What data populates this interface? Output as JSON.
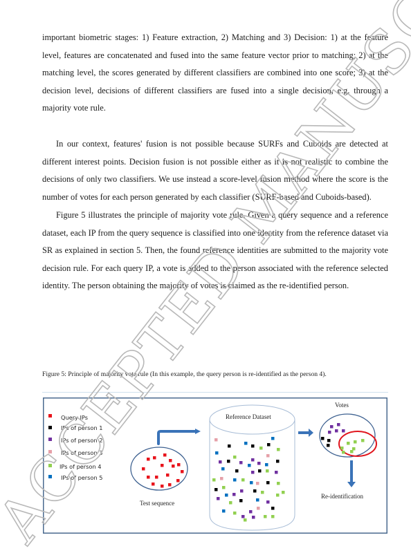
{
  "paragraphs": [
    {
      "text": "important biometric stages: 1) Feature extraction, 2) Matching and 3) Decision: 1) at the feature level, features are concatenated and fused into the same feature vector prior to matching; 2) at the matching level, the scores generated by different classifiers are combined into one score; 3) at the decision level, decisions of different classifiers are fused into a single decision, e.g.  through a majority vote rule.",
      "indent": false
    },
    {
      "text": "In our context, features' fusion is not possible because SURFs and Cuboids are detected at different interest points.  Decision fusion is not possible either as it is not realistic to combine the decisions of only two classifiers.  We use instead a score-level fusion method where the score is the number of votes for each person generated by each classifier (SURF-based and Cuboids-based).",
      "indent": true
    },
    {
      "text": "Figure 5 illustrates the principle of majority vote rule.  Given a query sequence and a reference dataset, each IP from the query sequence is classified into one identity from the reference dataset via SR as explained in section 5.  Then, the found reference identities are submitted to the majority vote decision rule. For each query IP, a vote is added to the person associated with the reference selected identity.  The person obtaining the majority of votes is claimed as the re-identified person.",
      "indent": true
    }
  ],
  "figure": {
    "caption": "Figure 5: Principle of majority vote rule (In this example, the query person is re-identified as the person 4).",
    "legend": [
      {
        "label": "Query IPs",
        "color": "#e8141c"
      },
      {
        "label": "IPs of person 1",
        "color": "#000000"
      },
      {
        "label": "IPs of person 2",
        "color": "#7030a0"
      },
      {
        "label": "IPs of person 3",
        "color": "#e6a0a8"
      },
      {
        "label": "IPs of person 4",
        "color": "#92d050"
      },
      {
        "label": "IPs of person 5",
        "color": "#0070c0"
      }
    ],
    "test_sequence_label": "Test sequence",
    "reference_dataset_label": "Reference Dataset",
    "votes_label": "Votes",
    "reidentification_label": "Re-identification",
    "query_ip_count": 16,
    "votes": {
      "person_1": 3,
      "person_2": 5,
      "person_4": 7
    },
    "winner": "person 4",
    "colors": {
      "frame": "#4a6a8f",
      "ellipse": "#3b5f8f",
      "arrow": "#3a73b8",
      "highlight": "#e0141c",
      "cylinder": "#a7bcd6"
    }
  },
  "watermark": "ACCEPTED MANUSCRIPT"
}
